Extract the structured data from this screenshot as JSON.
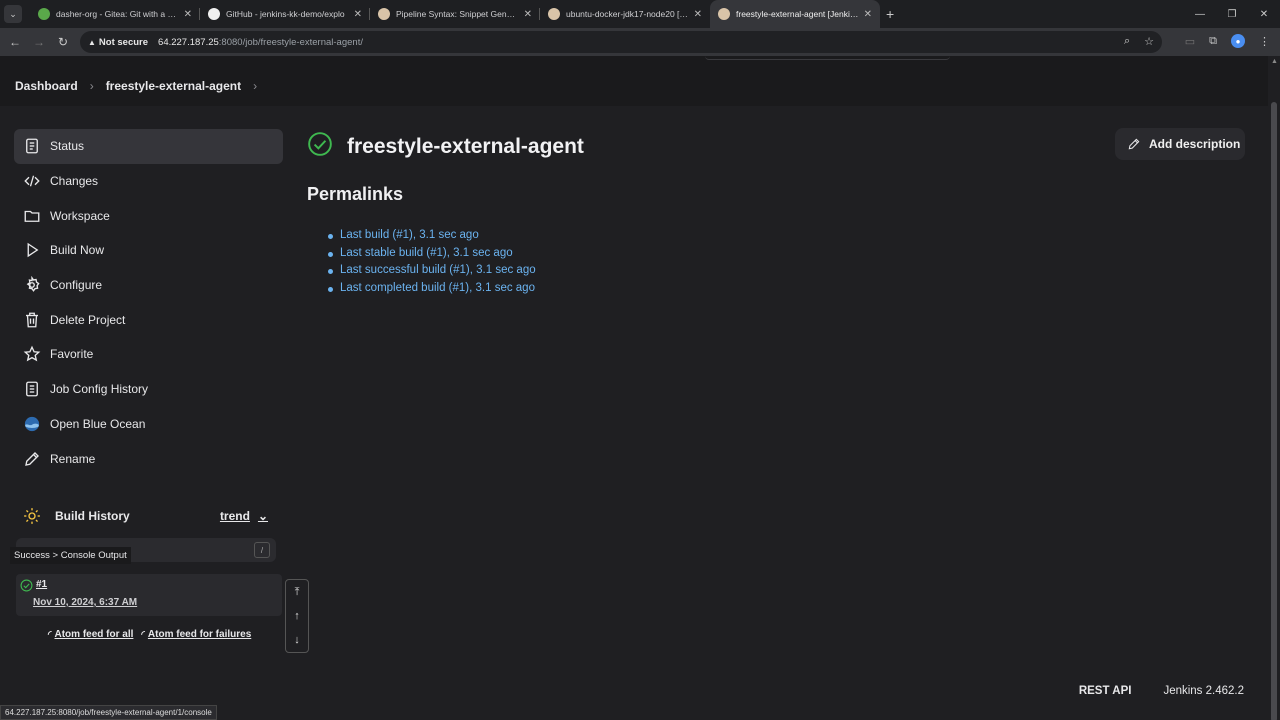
{
  "browser": {
    "tabs": [
      {
        "title": "dasher-org - Gitea: Git with a cup",
        "favicon_color": "#5aa84a",
        "active": false
      },
      {
        "title": "GitHub - jenkins-kk-demo/explo",
        "favicon_color": "#f0f0f0",
        "active": false
      },
      {
        "title": "Pipeline Syntax: Snippet Generator",
        "favicon_color": "#d9c4a8",
        "active": false
      },
      {
        "title": "ubuntu-docker-jdk17-node20 [Jenkins]",
        "favicon_color": "#d9c4a8",
        "active": false
      },
      {
        "title": "freestyle-external-agent [Jenkins]",
        "favicon_color": "#d9c4a8",
        "active": true
      }
    ],
    "address": {
      "security_label": "Not secure",
      "host": "64.227.187.25",
      "path": ":8080/job/freestyle-external-agent/"
    },
    "status_url": "64.227.187.25:8080/job/freestyle-external-agent/1/console"
  },
  "breadcrumb": {
    "dashboard": "Dashboard",
    "job": "freestyle-external-agent"
  },
  "sidebar": {
    "items": [
      {
        "label": "Status",
        "icon": "document-icon"
      },
      {
        "label": "Changes",
        "icon": "code-icon"
      },
      {
        "label": "Workspace",
        "icon": "folder-icon"
      },
      {
        "label": "Build Now",
        "icon": "play-icon"
      },
      {
        "label": "Configure",
        "icon": "gear-icon"
      },
      {
        "label": "Delete Project",
        "icon": "trash-icon"
      },
      {
        "label": "Favorite",
        "icon": "star-icon"
      },
      {
        "label": "Job Config History",
        "icon": "history-icon"
      },
      {
        "label": "Open Blue Ocean",
        "icon": "blue-ocean-icon"
      },
      {
        "label": "Rename",
        "icon": "pencil-icon"
      }
    ]
  },
  "build_history": {
    "title": "Build History",
    "trend_label": "trend",
    "filter_shortcut": "/",
    "tooltip": "Success > Console Output",
    "builds": [
      {
        "number": "#1",
        "date": "Nov 10, 2024, 6:37 AM",
        "status": "success"
      }
    ],
    "feed_all": "Atom feed for all",
    "feed_failures": "Atom feed for failures"
  },
  "main": {
    "job_title": "freestyle-external-agent",
    "add_description": "Add description",
    "permalinks_title": "Permalinks",
    "permalinks": [
      "Last build (#1), 3.1 sec ago",
      "Last stable build (#1), 3.1 sec ago",
      "Last successful build (#1), 3.1 sec ago",
      "Last completed build (#1), 3.1 sec ago"
    ]
  },
  "footer": {
    "rest_api": "REST API",
    "version": "Jenkins 2.462.2"
  },
  "colors": {
    "success": "#3fb950",
    "link": "#6bb3f0",
    "sun": "#f5c542"
  }
}
